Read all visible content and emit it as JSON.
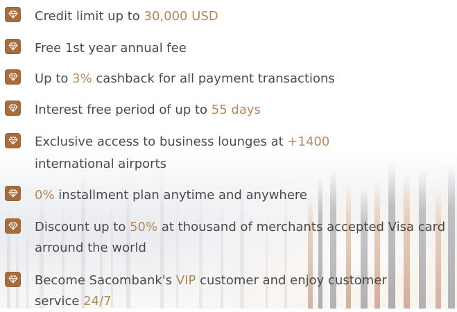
{
  "colors": {
    "accent": "#b08a5a",
    "bullet_bg": "#a66c3e",
    "text": "#4a4a4a"
  },
  "icon": "diamond-icon",
  "benefits": [
    {
      "pre": "Credit limit up to ",
      "hl": "30,000 USD",
      "post": "",
      "line2": ""
    },
    {
      "pre": "Free 1st year annual fee",
      "hl": "",
      "post": "",
      "line2": ""
    },
    {
      "pre": "Up to ",
      "hl": "3%",
      "post": " cashback for all payment transactions",
      "line2": ""
    },
    {
      "pre": "Interest free period of up to ",
      "hl": "55 days",
      "post": "",
      "line2": ""
    },
    {
      "pre": "Exclusive access to business lounges at ",
      "hl": "+1400",
      "post": "",
      "line2": "international airports"
    },
    {
      "pre": "",
      "hl": "0%",
      "post": " installment plan anytime and anywhere",
      "line2": ""
    },
    {
      "pre": "Discount up to ",
      "hl": "50%",
      "post": " at thousand of merchants accepted Visa card",
      "line2": "arround the world"
    },
    {
      "pre": "Become Sacombank's ",
      "hl": "VIP",
      "post": " customer and enjoy customer",
      "line2pre": "service ",
      "line2hl": "24/7"
    }
  ]
}
